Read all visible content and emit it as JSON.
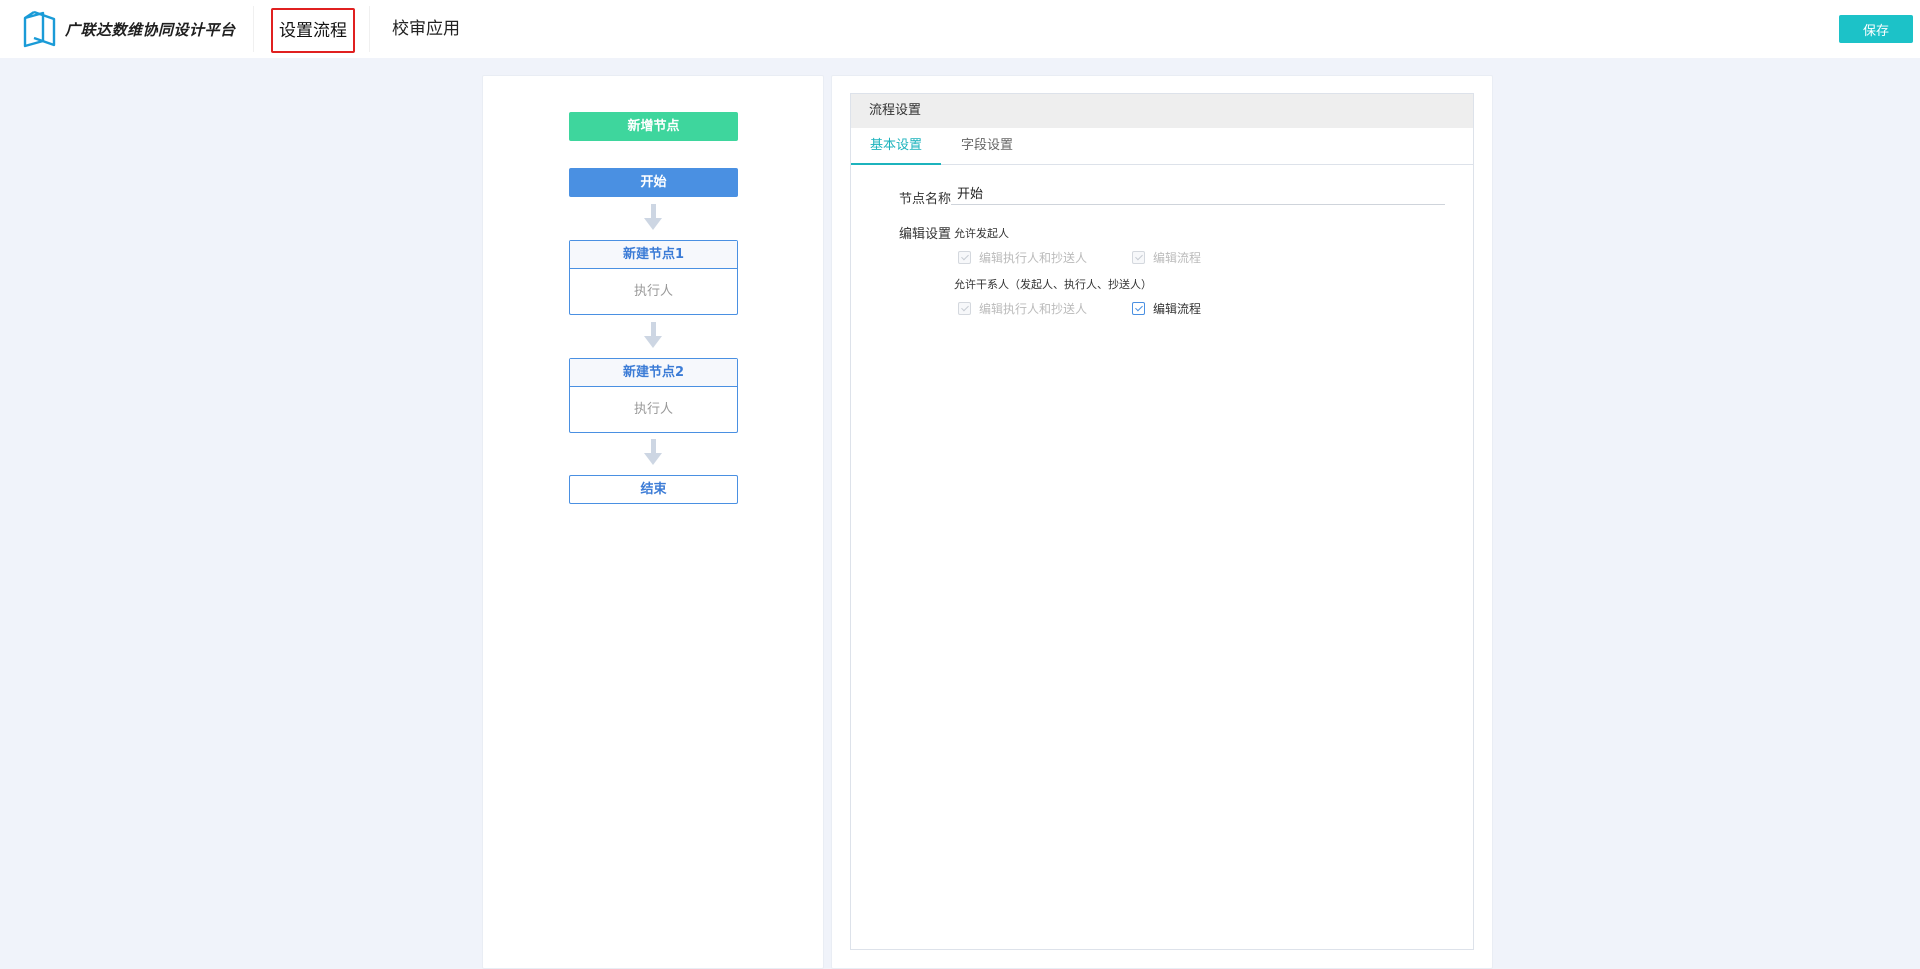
{
  "header": {
    "brand_name": "广联达数维协同设计平台",
    "brand_icon": "cube-logo-icon",
    "tabs": [
      {
        "label": "设置流程",
        "active": true
      },
      {
        "label": "校审应用",
        "active": false
      }
    ],
    "save_label": "保存"
  },
  "flow": {
    "add_node_label": "新增节点",
    "start_label": "开始",
    "nodes": [
      {
        "title": "新建节点1",
        "role": "执行人"
      },
      {
        "title": "新建节点2",
        "role": "执行人"
      }
    ],
    "end_label": "结束",
    "arrow_icon": "arrow-down-icon"
  },
  "settings": {
    "panel_title": "流程设置",
    "tabs": [
      {
        "label": "基本设置",
        "active": true
      },
      {
        "label": "字段设置",
        "active": false
      }
    ],
    "node_name_label": "节点名称",
    "node_name_value": "开始",
    "edit_settings_label": "编辑设置",
    "groups": [
      {
        "label": "允许发起人",
        "options": [
          {
            "label": "编辑执行人和抄送人",
            "checked": true,
            "disabled": true
          },
          {
            "label": "编辑流程",
            "checked": true,
            "disabled": true
          }
        ]
      },
      {
        "label": "允许干系人（发起人、执行人、抄送人）",
        "options": [
          {
            "label": "编辑执行人和抄送人",
            "checked": true,
            "disabled": true
          },
          {
            "label": "编辑流程",
            "checked": true,
            "disabled": false
          }
        ]
      }
    ]
  },
  "colors": {
    "accent": "#1cc2c8",
    "node_blue": "#4a90e2",
    "add_green": "#3ed69d",
    "highlight_red": "#e02020",
    "page_bg": "#f0f3fa"
  }
}
